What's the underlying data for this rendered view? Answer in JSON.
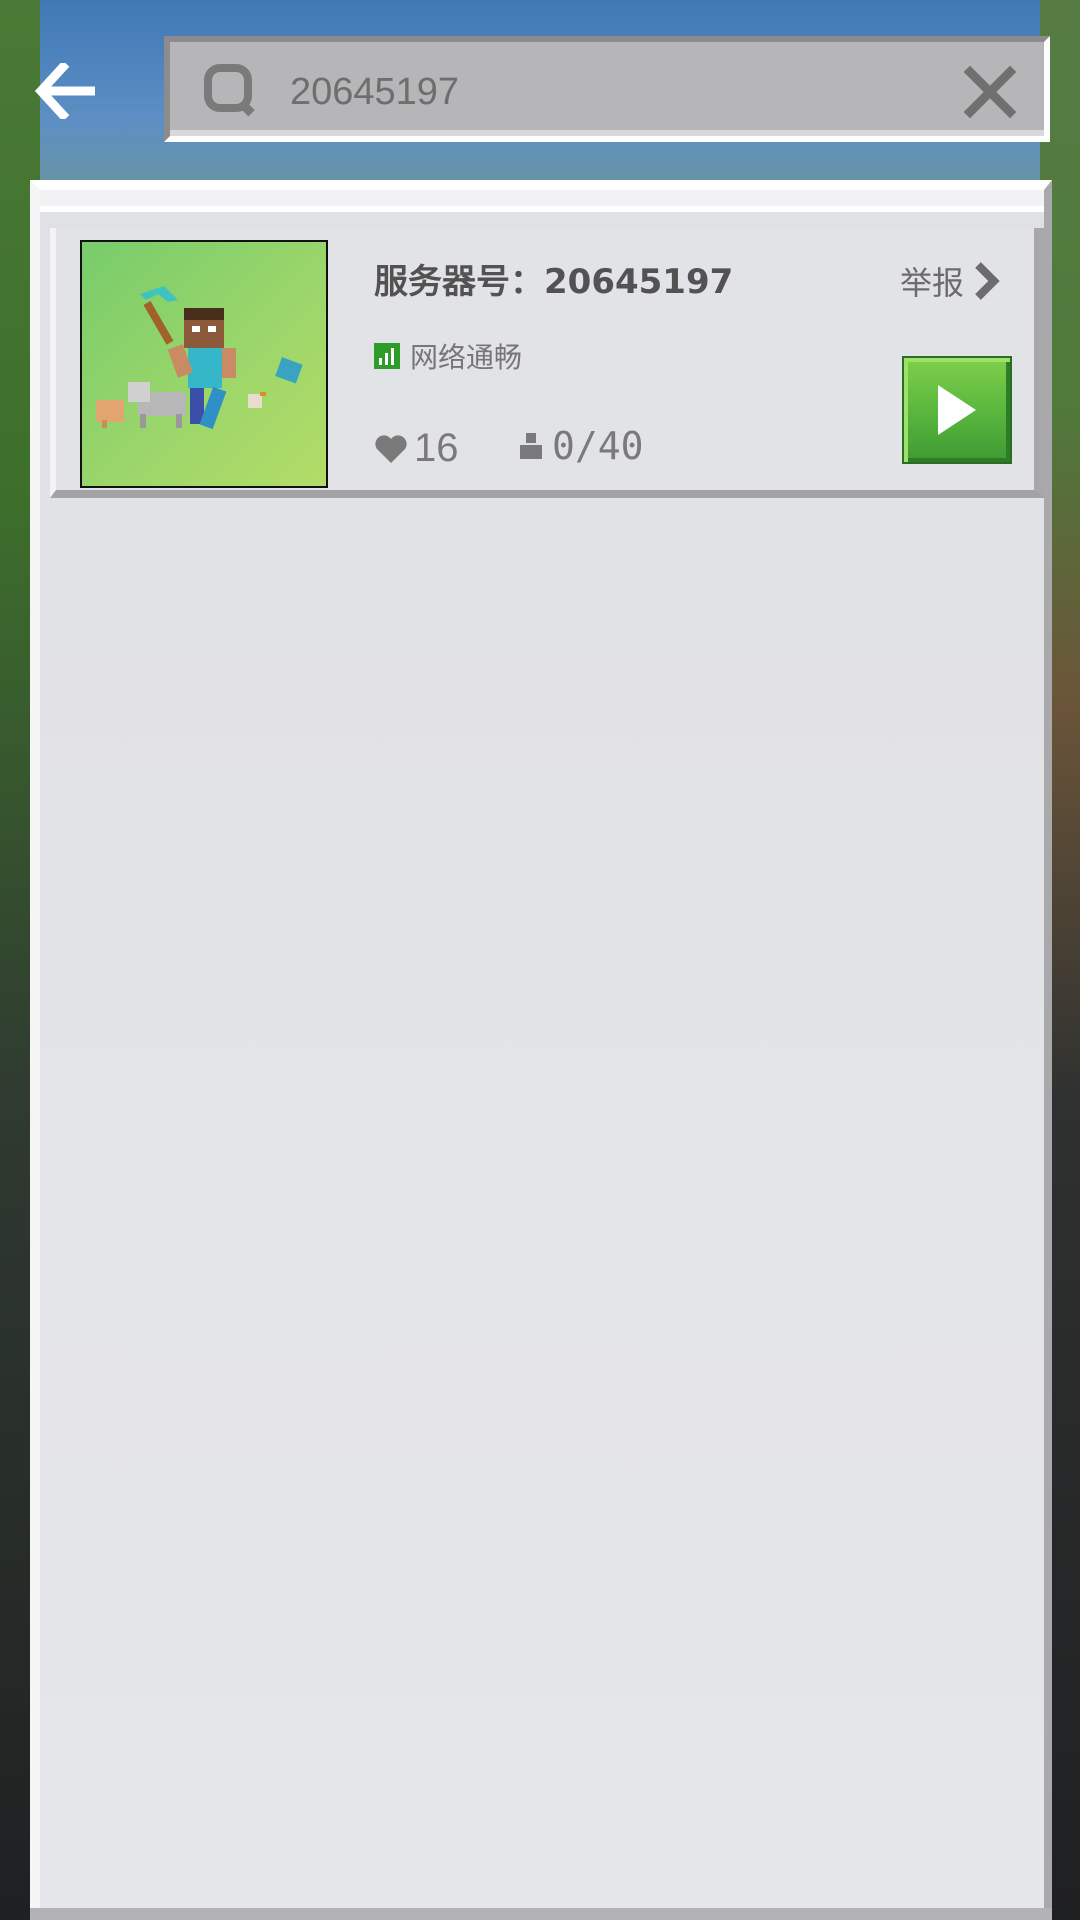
{
  "header": {
    "search_value": "20645197",
    "back_icon": "arrow-left-icon",
    "search_icon": "search-icon",
    "clear_icon": "close-icon"
  },
  "server_card": {
    "title": "服务器号：20645197",
    "report_label": "举报",
    "network_status": "网络通畅",
    "likes": "16",
    "players": "0/40",
    "status_color": "#2e9c28",
    "play_button_color": "#54b23c"
  }
}
